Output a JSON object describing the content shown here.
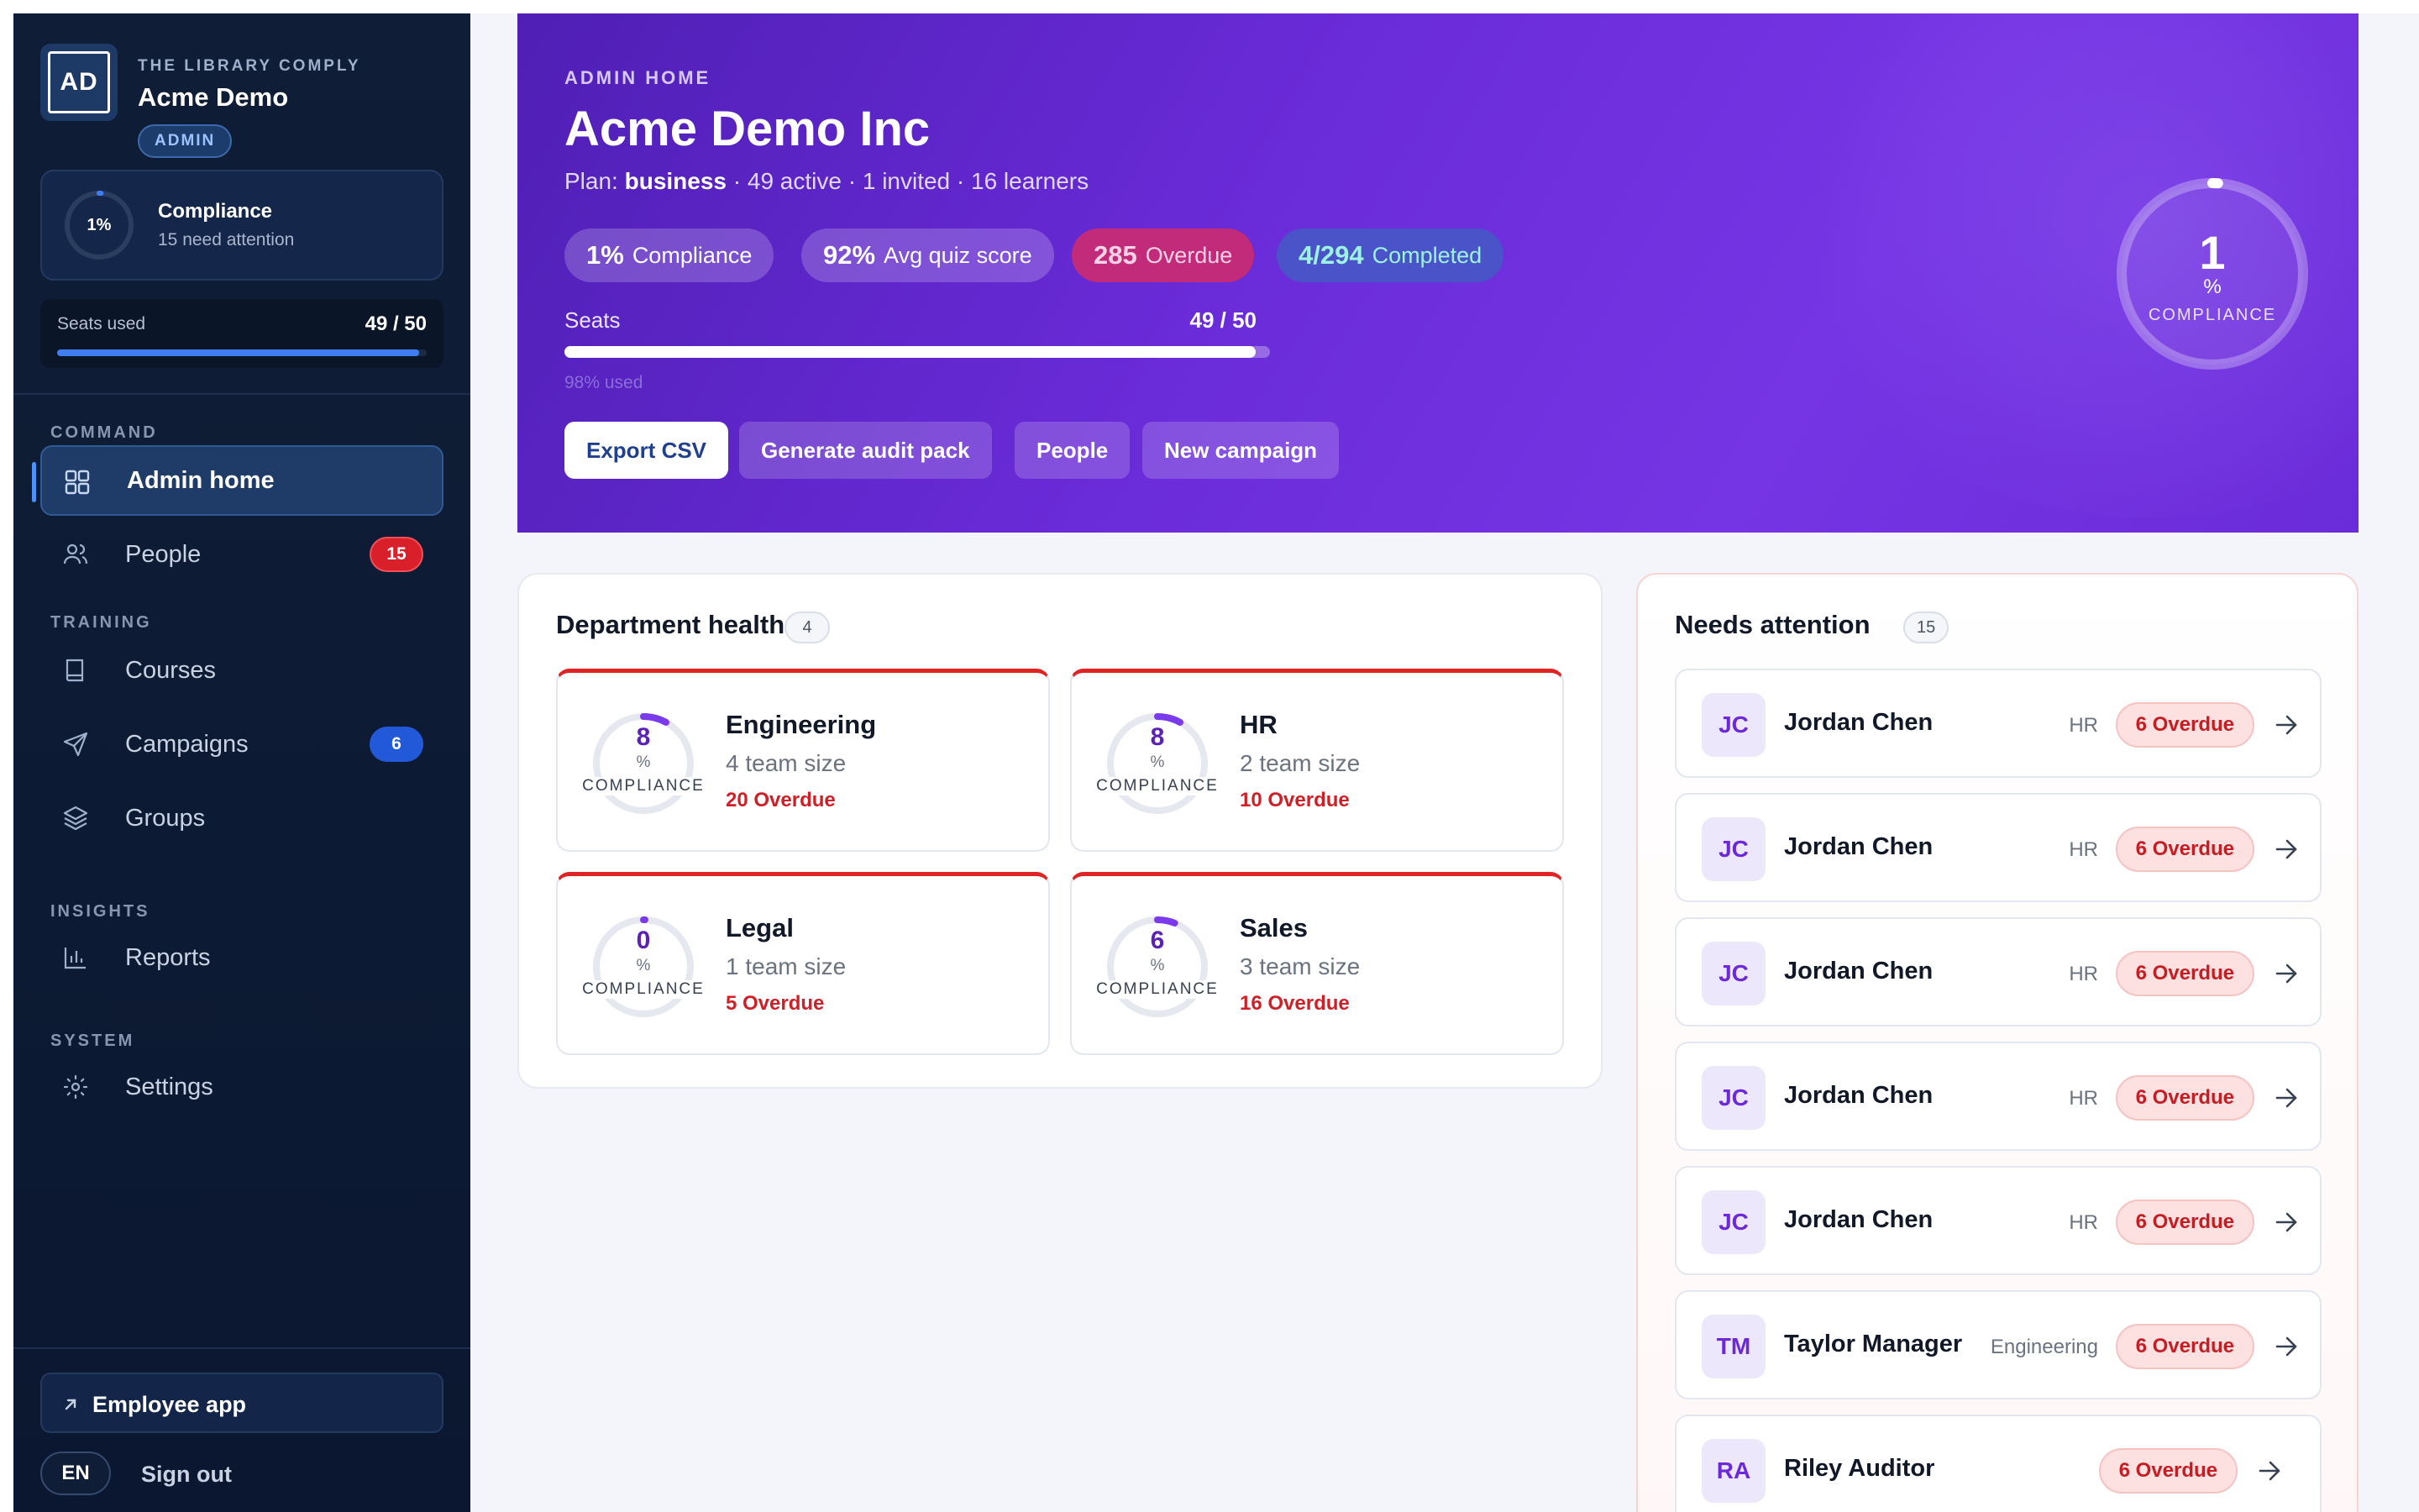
{
  "sidebar": {
    "brand": {
      "initials": "AD",
      "eyebrow": "THE LIBRARY COMPLY",
      "name": "Acme Demo",
      "role": "ADMIN"
    },
    "compliance": {
      "value": "1%",
      "title": "Compliance",
      "subtitle": "15 need attention",
      "fraction": 0.01
    },
    "seats": {
      "label": "Seats used",
      "value": "49 / 50",
      "fraction": 0.98
    },
    "sections": {
      "command": "COMMAND",
      "training": "TRAINING",
      "insights": "INSIGHTS",
      "system": "SYSTEM"
    },
    "items": [
      {
        "label": "Admin home",
        "icon": "grid-icon"
      },
      {
        "label": "People",
        "icon": "users-icon",
        "badge": "15"
      },
      {
        "label": "Courses",
        "icon": "book-icon"
      },
      {
        "label": "Campaigns",
        "icon": "send-icon",
        "badge": "6"
      },
      {
        "label": "Groups",
        "icon": "layers-icon"
      },
      {
        "label": "Reports",
        "icon": "bar-chart-icon"
      },
      {
        "label": "Settings",
        "icon": "gear-icon"
      }
    ],
    "employee_app": "Employee app",
    "language": "EN",
    "sign_out": "Sign out"
  },
  "hero": {
    "eyebrow": "ADMIN HOME",
    "title": "Acme Demo Inc",
    "plan_prefix": "Plan:",
    "plan_name": "business",
    "plan_rest": "· 49 active · 1 invited · 16 learners",
    "stats": [
      {
        "num": "1%",
        "label": "Compliance"
      },
      {
        "num": "92%",
        "label": "Avg quiz score"
      },
      {
        "num": "285",
        "label": "Overdue"
      },
      {
        "num": "4/294",
        "label": "Completed"
      }
    ],
    "seats_label": "Seats",
    "seats_value": "49 / 50",
    "seats_fraction": 0.98,
    "seats_note": "98% used",
    "buttons": [
      "Export CSV",
      "Generate audit pack",
      "People",
      "New campaign"
    ],
    "ring": {
      "num": "1",
      "pct": "%",
      "label": "COMPLIANCE",
      "fraction": 0.01
    }
  },
  "departments": {
    "title": "Department health",
    "count": "4",
    "items": [
      {
        "num": "8",
        "pct": "%",
        "ring_label": "COMPLIANCE",
        "name": "Engineering",
        "size": "4 team size",
        "overdue": "20 Overdue",
        "fraction": 0.08
      },
      {
        "num": "8",
        "pct": "%",
        "ring_label": "COMPLIANCE",
        "name": "HR",
        "size": "2 team size",
        "overdue": "10 Overdue",
        "fraction": 0.08
      },
      {
        "num": "0",
        "pct": "%",
        "ring_label": "COMPLIANCE",
        "name": "Legal",
        "size": "1 team size",
        "overdue": "5 Overdue",
        "fraction": 0.0
      },
      {
        "num": "6",
        "pct": "%",
        "ring_label": "COMPLIANCE",
        "name": "Sales",
        "size": "3 team size",
        "overdue": "16 Overdue",
        "fraction": 0.06
      }
    ]
  },
  "attention": {
    "title": "Needs attention",
    "count": "15",
    "rows": [
      {
        "initials": "JC",
        "name": "Jordan Chen",
        "dept": "HR",
        "badge": "6 Overdue"
      },
      {
        "initials": "JC",
        "name": "Jordan Chen",
        "dept": "HR",
        "badge": "6 Overdue"
      },
      {
        "initials": "JC",
        "name": "Jordan Chen",
        "dept": "HR",
        "badge": "6 Overdue"
      },
      {
        "initials": "JC",
        "name": "Jordan Chen",
        "dept": "HR",
        "badge": "6 Overdue"
      },
      {
        "initials": "JC",
        "name": "Jordan Chen",
        "dept": "HR",
        "badge": "6 Overdue"
      },
      {
        "initials": "TM",
        "name": "Taylor Manager",
        "dept": "Engineering",
        "badge": "6 Overdue"
      },
      {
        "initials": "RA",
        "name": "Riley Auditor",
        "dept": "",
        "badge": "6 Overdue"
      }
    ]
  },
  "colors": {
    "hero_purple": "#6a2bd8",
    "sidebar_navy": "#0f1d36",
    "accent_blue": "#3f7ef0",
    "overdue_red": "#d01f26"
  }
}
